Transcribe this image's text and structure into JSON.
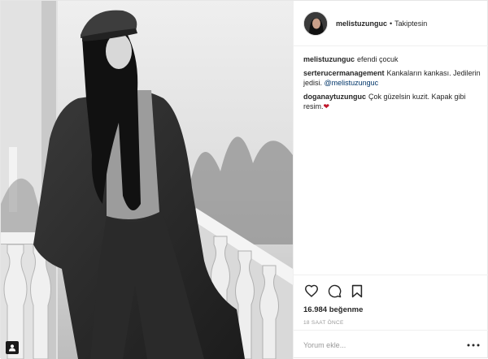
{
  "post": {
    "author": {
      "username": "melistuzunguc",
      "separator": "•",
      "follow_label": "Takiptesin"
    },
    "comments": [
      {
        "user": "melistuzunguc",
        "text": "efendi çocuk",
        "mention": ""
      },
      {
        "user": "serterucermanagement",
        "text": "Kankaların kankası. Jedilerin jedisi. ",
        "mention": "@melistuzunguc"
      },
      {
        "user": "doganaytuzunguc",
        "text": "Çok güzelsin kuzit. Kapak gibi resim.",
        "mention": ""
      }
    ],
    "likes": "16.984 beğenme",
    "timestamp": "18 SAAT ÖNCE",
    "comment_placeholder": "Yorum ekle...",
    "icons": {
      "like": "heart-icon",
      "comment": "speech-bubble-icon",
      "save": "bookmark-icon",
      "more": "ellipsis-icon",
      "tagged": "user-tag-icon"
    },
    "colors": {
      "text": "#262626",
      "muted": "#999999",
      "mention": "#003569",
      "divider": "#efefef"
    }
  }
}
